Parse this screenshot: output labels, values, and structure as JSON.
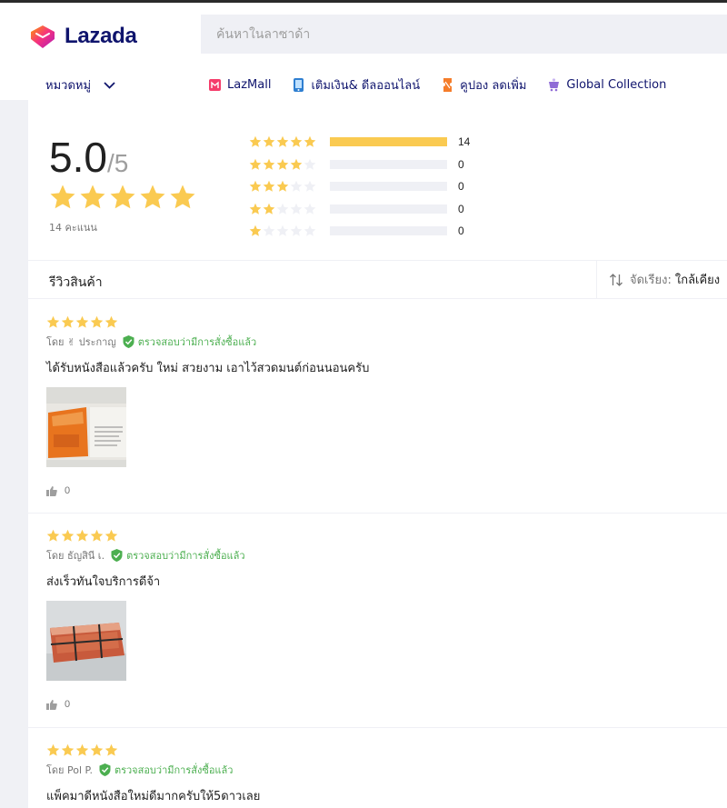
{
  "header": {
    "logo_text": "Lazada",
    "search_placeholder": "ค้นหาในลาซาด้า",
    "category_label": "หมวดหมู่",
    "nav_links": [
      {
        "label": "LazMall",
        "icon": "lazmall-icon"
      },
      {
        "label": "เติมเงิน& ดีลออนไลน์",
        "icon": "topup-phone-icon"
      },
      {
        "label": "คูปอง ลดเพิ่ม",
        "icon": "coupon-icon"
      },
      {
        "label": "Global Collection",
        "icon": "global-cart-icon"
      }
    ]
  },
  "rating": {
    "average": "5.0",
    "max": "/5",
    "count_text": "14 คะแนน",
    "distribution": [
      {
        "stars": 5,
        "count": "14",
        "fraction": 1.0
      },
      {
        "stars": 4,
        "count": "0",
        "fraction": 0
      },
      {
        "stars": 3,
        "count": "0",
        "fraction": 0
      },
      {
        "stars": 2,
        "count": "0",
        "fraction": 0
      },
      {
        "stars": 1,
        "count": "0",
        "fraction": 0
      }
    ]
  },
  "reviews_section": {
    "title": "รีวิวสินค้า",
    "sort_label": "จัดเรียง:",
    "sort_value": "ใกล้เคียง"
  },
  "reviews": [
    {
      "stars": 5,
      "author": "โดย ✌ ประกาญ",
      "verified": "ตรวจสอบว่ามีการสั่งซื้อแล้ว",
      "text": "ได้รับหนังสือแล้วครับ  ใหม่ สวยงาม เอาไว้สวดมนต์ก่อนนอนครับ",
      "likes": "0"
    },
    {
      "stars": 5,
      "author": "โดย ธัญสินี เ.",
      "verified": "ตรวจสอบว่ามีการสั่งซื้อแล้ว",
      "text": "ส่งเร็วทันใจบริการดีจ้า",
      "likes": "0"
    },
    {
      "stars": 5,
      "author": "โดย Pol P.",
      "verified": "ตรวจสอบว่ามีการสั่งซื้อแล้ว",
      "text": "แพ็คมาดีหนังสือใหม่ดีมากครับให้5ดาวเลย",
      "likes": ""
    }
  ],
  "colors": {
    "star": "#faca51",
    "brand_navy": "#0f146d",
    "verified_green": "#4caf50"
  }
}
